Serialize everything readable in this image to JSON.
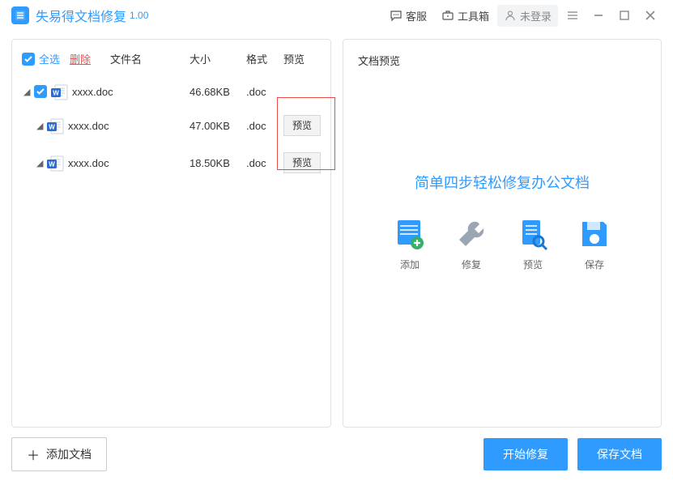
{
  "app": {
    "title": "失易得文档修复",
    "version": "1.00"
  },
  "titlebar": {
    "support": "客服",
    "toolbox": "工具箱",
    "login": "未登录"
  },
  "left": {
    "select_all": "全选",
    "delete": "删除",
    "cols": {
      "name": "文件名",
      "size": "大小",
      "fmt": "格式",
      "prev": "预览"
    },
    "rows": [
      {
        "indent": 0,
        "checked": true,
        "expanded": true,
        "name": "xxxx.doc",
        "size": "46.68KB",
        "fmt": ".doc",
        "has_preview": false
      },
      {
        "indent": 1,
        "checked": false,
        "expanded": true,
        "name": "xxxx.doc",
        "size": "47.00KB",
        "fmt": ".doc",
        "has_preview": true
      },
      {
        "indent": 1,
        "checked": false,
        "expanded": true,
        "name": "xxxx.doc",
        "size": "18.50KB",
        "fmt": ".doc",
        "has_preview": true
      }
    ],
    "preview_btn": "预览"
  },
  "right": {
    "header": "文档预览",
    "big_title": "简单四步轻松修复办公文档",
    "steps": {
      "add": "添加",
      "repair": "修复",
      "preview": "预览",
      "save": "保存"
    }
  },
  "footer": {
    "add_doc": "添加文档",
    "start_repair": "开始修复",
    "save_doc": "保存文档"
  }
}
